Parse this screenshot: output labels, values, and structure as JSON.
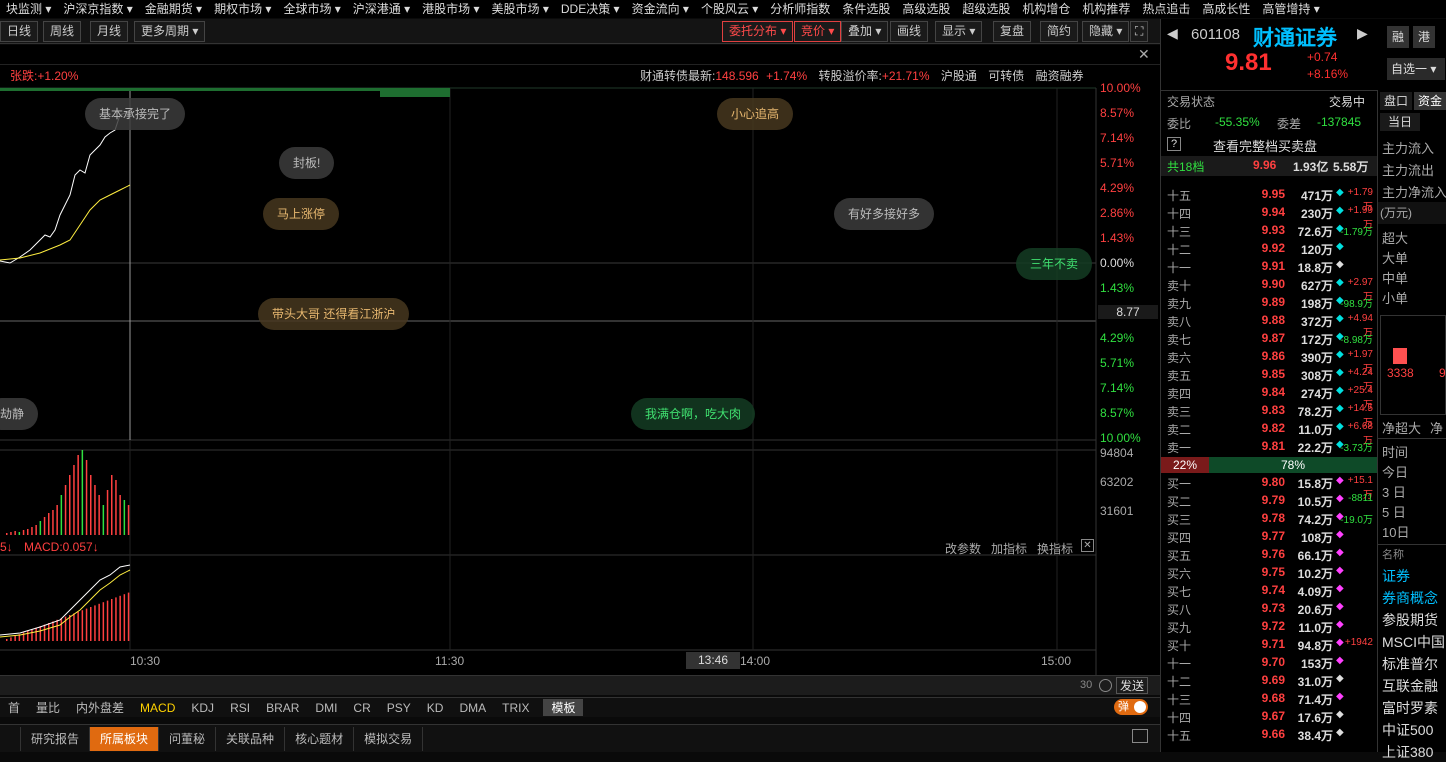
{
  "menubar": {
    "items": [
      "块监测 ▾",
      "沪深京指数 ▾",
      "金融期货 ▾",
      "期权市场 ▾",
      "全球市场 ▾",
      "沪深港通 ▾",
      "港股市场 ▾",
      "美股市场 ▾",
      "DDE决策 ▾",
      "资金流向 ▾",
      "个股风云 ▾",
      "分析师指数",
      "条件选股",
      "高级选股",
      "超级选股",
      "机构增仓",
      "机构推荐",
      "热点追击",
      "高成长性",
      "高管增持 ▾"
    ]
  },
  "periodbar": {
    "day": "日线",
    "week": "周线",
    "month": "月线",
    "more": "更多周期 ▾",
    "entrust": "委托分布 ▾",
    "bid": "竞价 ▾",
    "overlay": "叠加 ▾",
    "draw": "画线",
    "display": "显示 ▾",
    "restore": "复盘",
    "simple": "简约",
    "hide": "隐藏 ▾",
    "expand_icon": "⛶"
  },
  "close_icon": "✕",
  "info": {
    "change": "张跌:+1.20%",
    "bond_label": "财通转债最新:",
    "bond_price": "148.596",
    "bond_pct": "+1.74%",
    "premium_label": "转股溢价率:",
    "premium_val": "+21.71%",
    "hgt": "沪股通",
    "convert": "可转债",
    "margin": "融资融券"
  },
  "pct_labels_red": [
    "10.00%",
    "8.57%",
    "7.14%",
    "5.71%",
    "4.29%",
    "2.86%",
    "1.43%"
  ],
  "pct_zero": "0.00%",
  "pct_labels_green": [
    "1.43%",
    "4.29%",
    "5.71%",
    "7.14%",
    "8.57%",
    "10.00%"
  ],
  "price_tag": "8.77",
  "bubbles": [
    "基本承接完了",
    "小心追高",
    "封板!",
    "马上涨停",
    "有好多接好多",
    "三年不卖",
    "带头大哥 还得看江浙沪",
    "劫静",
    "我满仓啊，吃大肉"
  ],
  "volume_labels": [
    "94804",
    "63202",
    "31601"
  ],
  "macd": {
    "label": "5↓",
    "macd": "MACD:0.057↓",
    "adjust": "改参数",
    "add": "加指标",
    "switch": "换指标",
    "close": "✕"
  },
  "time_axis": [
    "10:30",
    "11:30",
    "13:46",
    "14:00",
    "15:00"
  ],
  "send_bar": {
    "count": "30",
    "send": "发送"
  },
  "indicators": [
    "首",
    "量比",
    "内外盘差",
    "MACD",
    "KDJ",
    "RSI",
    "BRAR",
    "DMI",
    "CR",
    "PSY",
    "KD",
    "DMA",
    "TRIX",
    "模板"
  ],
  "toggle": "弹",
  "tabs2": [
    "研究报告",
    "所属板块",
    "问董秘",
    "关联品种",
    "核心题材",
    "模拟交易"
  ],
  "stock": {
    "code": "601108",
    "name": "财通证券",
    "price": "9.81",
    "change": "+0.74",
    "pct": "+8.16%",
    "btn1": "融",
    "btn2": "港",
    "select": "自选一 ▾"
  },
  "status": {
    "label": "交易状态",
    "value": "交易中",
    "wb_label": "委比",
    "wb": "-55.35%",
    "wc_label": "委差",
    "wc": "-137845",
    "view_full": "查看完整档买卖盘",
    "q": "?",
    "levels": "共18档",
    "top_price": "9.96",
    "top_amt": "1.93亿",
    "top_vol": "5.58万"
  },
  "sells": [
    {
      "l": "十五",
      "p": "9.95",
      "v": "471万",
      "c": "+1.79万",
      "cc": "r",
      "dc": "c"
    },
    {
      "l": "十四",
      "p": "9.94",
      "v": "230万",
      "c": "+1.99万",
      "cc": "r",
      "dc": "c"
    },
    {
      "l": "十三",
      "p": "9.93",
      "v": "72.6万",
      "c": "-1.79万",
      "cc": "g",
      "dc": "c"
    },
    {
      "l": "十二",
      "p": "9.92",
      "v": "120万",
      "c": "",
      "cc": "r",
      "dc": "c"
    },
    {
      "l": "十一",
      "p": "9.91",
      "v": "18.8万",
      "c": "",
      "cc": "r",
      "dc": "w"
    },
    {
      "l": "卖十",
      "p": "9.90",
      "v": "627万",
      "c": "+2.97万",
      "cc": "r",
      "dc": "c"
    },
    {
      "l": "卖九",
      "p": "9.89",
      "v": "198万",
      "c": "-98.9万",
      "cc": "g",
      "dc": "c"
    },
    {
      "l": "卖八",
      "p": "9.88",
      "v": "372万",
      "c": "+4.94万",
      "cc": "r",
      "dc": "c"
    },
    {
      "l": "卖七",
      "p": "9.87",
      "v": "172万",
      "c": "-8.98万",
      "cc": "g",
      "dc": "c"
    },
    {
      "l": "卖六",
      "p": "9.86",
      "v": "390万",
      "c": "+1.97万",
      "cc": "r",
      "dc": "c"
    },
    {
      "l": "卖五",
      "p": "9.85",
      "v": "308万",
      "c": "+4.24万",
      "cc": "r",
      "dc": "c"
    },
    {
      "l": "卖四",
      "p": "9.84",
      "v": "274万",
      "c": "+25.4万",
      "cc": "r",
      "dc": "c"
    },
    {
      "l": "卖三",
      "p": "9.83",
      "v": "78.2万",
      "c": "+14.5万",
      "cc": "r",
      "dc": "c"
    },
    {
      "l": "卖二",
      "p": "9.82",
      "v": "11.0万",
      "c": "+6.68万",
      "cc": "r",
      "dc": "c"
    },
    {
      "l": "卖一",
      "p": "9.81",
      "v": "22.2万",
      "c": "-3.73万",
      "cc": "g",
      "dc": "c"
    }
  ],
  "ratio": {
    "left": "22%",
    "right": "78%"
  },
  "buys": [
    {
      "l": "买一",
      "p": "9.80",
      "v": "15.8万",
      "c": "+15.1万",
      "cc": "r",
      "dc": "m"
    },
    {
      "l": "买二",
      "p": "9.79",
      "v": "10.5万",
      "c": "-8811",
      "cc": "g",
      "dc": "m"
    },
    {
      "l": "买三",
      "p": "9.78",
      "v": "74.2万",
      "c": "-19.0万",
      "cc": "g",
      "dc": "m"
    },
    {
      "l": "买四",
      "p": "9.77",
      "v": "108万",
      "c": "",
      "cc": "r",
      "dc": "m"
    },
    {
      "l": "买五",
      "p": "9.76",
      "v": "66.1万",
      "c": "",
      "cc": "r",
      "dc": "m"
    },
    {
      "l": "买六",
      "p": "9.75",
      "v": "10.2万",
      "c": "",
      "cc": "r",
      "dc": "m"
    },
    {
      "l": "买七",
      "p": "9.74",
      "v": "4.09万",
      "c": "",
      "cc": "r",
      "dc": "m"
    },
    {
      "l": "买八",
      "p": "9.73",
      "v": "20.6万",
      "c": "",
      "cc": "r",
      "dc": "m"
    },
    {
      "l": "买九",
      "p": "9.72",
      "v": "11.0万",
      "c": "",
      "cc": "r",
      "dc": "m"
    },
    {
      "l": "买十",
      "p": "9.71",
      "v": "94.8万",
      "c": "+1942",
      "cc": "r",
      "dc": "m"
    },
    {
      "l": "十一",
      "p": "9.70",
      "v": "153万",
      "c": "",
      "cc": "r",
      "dc": "m"
    },
    {
      "l": "十二",
      "p": "9.69",
      "v": "31.0万",
      "c": "",
      "cc": "r",
      "dc": "w"
    },
    {
      "l": "十三",
      "p": "9.68",
      "v": "71.4万",
      "c": "",
      "cc": "r",
      "dc": "m"
    },
    {
      "l": "十四",
      "p": "9.67",
      "v": "17.6万",
      "c": "",
      "cc": "r",
      "dc": "w"
    },
    {
      "l": "十五",
      "p": "9.66",
      "v": "38.4万",
      "c": "",
      "cc": "r",
      "dc": "w"
    }
  ],
  "panel3": {
    "tab1": "盘口",
    "tab2": "资金",
    "today": "当日",
    "in": "主力流入",
    "out": "主力流出",
    "net": "主力净流入",
    "unit": "(万元)",
    "super": "超大",
    "big": "大单",
    "mid": "中单",
    "small": "小单",
    "bar_val": "3338",
    "bar_val2": "9",
    "net_super": "净超大",
    "net2": "净",
    "time": "时间",
    "d0": "今日",
    "d3": "3 日",
    "d5": "5 日",
    "d10": "10日",
    "name": "名称",
    "sector": "证券",
    "s1": "券商概念",
    "s2": "参股期货",
    "s3": "MSCI中国",
    "s4": "标准普尔",
    "s5": "互联金融",
    "s6": "富时罗素",
    "s7": "中证500",
    "s8": "上证380"
  }
}
